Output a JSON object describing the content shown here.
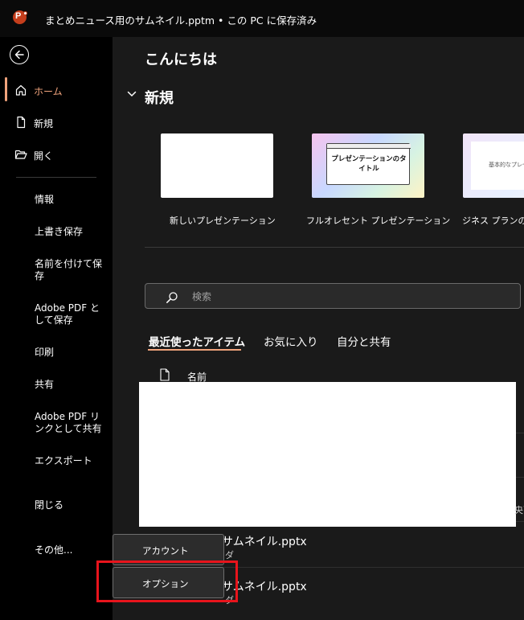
{
  "window": {
    "title": "まとめニュース用のサムネイル.pptm • この PC に保存済み",
    "app_icon": "powerpoint-icon"
  },
  "colors": {
    "accent": "#f0a37c",
    "highlight": "#e8141c",
    "app_brand": "#c43e1c"
  },
  "sidebar": {
    "back_icon": "back-arrow-icon",
    "nav": [
      {
        "label": "ホーム",
        "icon": "home-icon"
      },
      {
        "label": "新規",
        "icon": "new-file-icon"
      },
      {
        "label": "開く",
        "icon": "folder-open-icon"
      }
    ],
    "menu": [
      {
        "label": "情報"
      },
      {
        "label": "上書き保存"
      },
      {
        "label": "名前を付けて保存"
      },
      {
        "label": "Adobe PDF として保存"
      },
      {
        "label": "印刷"
      },
      {
        "label": "共有"
      },
      {
        "label": "Adobe PDF リンクとして共有"
      },
      {
        "label": "エクスポート"
      },
      {
        "label": "閉じる"
      },
      {
        "label": "その他..."
      }
    ]
  },
  "main": {
    "greeting": "こんにちは",
    "new_section": {
      "title": "新規",
      "templates": [
        {
          "caption": "新しいプレゼンテーション",
          "thumb_text": ""
        },
        {
          "caption": "フルオレセント プレゼンテーション",
          "thumb_text": "プレゼンテーションのタイトル"
        },
        {
          "caption": "ビジネス プランのプ",
          "thumb_text": "基本的なプレゼ"
        }
      ]
    },
    "search": {
      "placeholder": "検索",
      "value": ""
    },
    "tabs": [
      {
        "label": "最近使ったアイテム",
        "selected": true
      },
      {
        "label": "お気に入り",
        "selected": false
      },
      {
        "label": "自分と共有",
        "selected": false
      }
    ],
    "file_list": {
      "column_name": "名前",
      "partial_edge_text": "央面",
      "rows": [
        {
          "name": "サムネイル.pptx",
          "sub": "ダ"
        },
        {
          "name": "サムネイル.pptx",
          "sub": "ダ"
        }
      ]
    }
  },
  "more_menu": {
    "items": [
      {
        "label": "アカウント"
      },
      {
        "label": "オプション"
      }
    ]
  }
}
